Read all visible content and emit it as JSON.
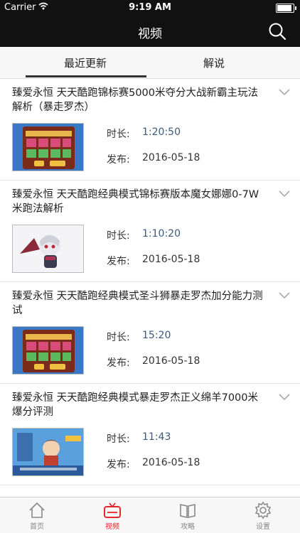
{
  "status": {
    "carrier": "Carrier",
    "time": "9:19 AM"
  },
  "nav": {
    "title": "视频"
  },
  "tabs": {
    "recent": "最近更新",
    "commentary": "解说"
  },
  "items": [
    {
      "title": "臻爱永恒 天天酷跑锦标赛5000米夺分大战新霸主玩法解析（暴走罗杰）",
      "duration_label": "时长:",
      "duration": "1:20:50",
      "publish_label": "发布:",
      "publish": "2016-05-18",
      "thumb": "slot-game-screen"
    },
    {
      "title": "臻爱永恒  天天酷跑经典模式锦标赛版本魔女娜娜0-7W米跑法解析",
      "duration_label": "时长:",
      "duration": "1:10:20",
      "publish_label": "发布:",
      "publish": "2016-05-18",
      "thumb": "anime-character"
    },
    {
      "title": "臻爱永恒 天天酷跑经典模式圣斗狮暴走罗杰加分能力测试",
      "duration_label": "时长:",
      "duration": "15:20",
      "publish_label": "发布:",
      "publish": "2016-05-18",
      "thumb": "slot-game-screen"
    },
    {
      "title": "臻爱永恒  天天酷跑经典模式暴走罗杰正义绵羊7000米爆分评测",
      "duration_label": "时长:",
      "duration": "11:43",
      "publish_label": "发布:",
      "publish": "2016-05-18",
      "thumb": "game-screenshot"
    }
  ],
  "tabbar": [
    {
      "label": "首页",
      "icon": "home-icon"
    },
    {
      "label": "视频",
      "icon": "tv-icon",
      "active": true
    },
    {
      "label": "攻略",
      "icon": "book-icon"
    },
    {
      "label": "设置",
      "icon": "gear-icon"
    }
  ],
  "colors": {
    "accent": "#e5262c",
    "nav_bg": "#111111"
  }
}
